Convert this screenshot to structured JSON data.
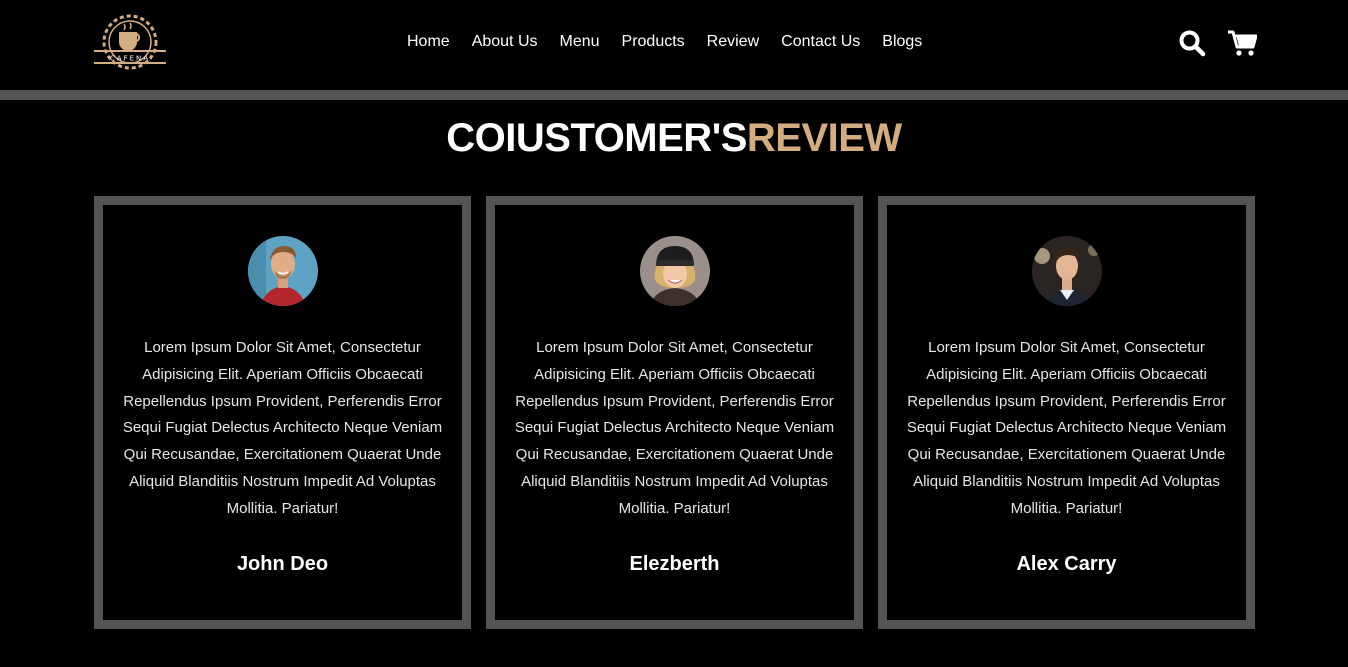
{
  "header": {
    "logo_text": "CAFENA",
    "nav": [
      "Home",
      "About Us",
      "Menu",
      "Products",
      "Review",
      "Contact Us",
      "Blogs"
    ],
    "icons": [
      "search-icon",
      "cart-icon"
    ]
  },
  "section": {
    "title_main": "COIUSTOMER'S",
    "title_accent": "REVIEW",
    "accent_color": "#d3ad7f"
  },
  "reviews": [
    {
      "text": "Lorem Ipsum Dolor Sit Amet, Consectetur Adipisicing Elit. Aperiam Officiis Obcaecati Repellendus Ipsum Provident, Perferendis Error Sequi Fugiat Delectus Architecto Neque Veniam Qui Recusandae, Exercitationem Quaerat Unde Aliquid Blanditiis Nostrum Impedit Ad Voluptas Mollitia. Pariatur!",
      "name": "John Deo"
    },
    {
      "text": "Lorem Ipsum Dolor Sit Amet, Consectetur Adipisicing Elit. Aperiam Officiis Obcaecati Repellendus Ipsum Provident, Perferendis Error Sequi Fugiat Delectus Architecto Neque Veniam Qui Recusandae, Exercitationem Quaerat Unde Aliquid Blanditiis Nostrum Impedit Ad Voluptas Mollitia. Pariatur!",
      "name": "Elezberth"
    },
    {
      "text": "Lorem Ipsum Dolor Sit Amet, Consectetur Adipisicing Elit. Aperiam Officiis Obcaecati Repellendus Ipsum Provident, Perferendis Error Sequi Fugiat Delectus Architecto Neque Veniam Qui Recusandae, Exercitationem Quaerat Unde Aliquid Blanditiis Nostrum Impedit Ad Voluptas Mollitia. Pariatur!",
      "name": "Alex Carry"
    }
  ]
}
